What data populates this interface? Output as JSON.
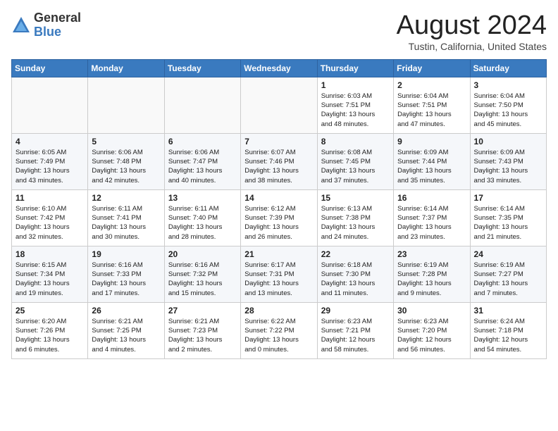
{
  "header": {
    "logo_line1": "General",
    "logo_line2": "Blue",
    "month_title": "August 2024",
    "location": "Tustin, California, United States"
  },
  "weekdays": [
    "Sunday",
    "Monday",
    "Tuesday",
    "Wednesday",
    "Thursday",
    "Friday",
    "Saturday"
  ],
  "weeks": [
    [
      {
        "day": "",
        "info": ""
      },
      {
        "day": "",
        "info": ""
      },
      {
        "day": "",
        "info": ""
      },
      {
        "day": "",
        "info": ""
      },
      {
        "day": "1",
        "info": "Sunrise: 6:03 AM\nSunset: 7:51 PM\nDaylight: 13 hours\nand 48 minutes."
      },
      {
        "day": "2",
        "info": "Sunrise: 6:04 AM\nSunset: 7:51 PM\nDaylight: 13 hours\nand 47 minutes."
      },
      {
        "day": "3",
        "info": "Sunrise: 6:04 AM\nSunset: 7:50 PM\nDaylight: 13 hours\nand 45 minutes."
      }
    ],
    [
      {
        "day": "4",
        "info": "Sunrise: 6:05 AM\nSunset: 7:49 PM\nDaylight: 13 hours\nand 43 minutes."
      },
      {
        "day": "5",
        "info": "Sunrise: 6:06 AM\nSunset: 7:48 PM\nDaylight: 13 hours\nand 42 minutes."
      },
      {
        "day": "6",
        "info": "Sunrise: 6:06 AM\nSunset: 7:47 PM\nDaylight: 13 hours\nand 40 minutes."
      },
      {
        "day": "7",
        "info": "Sunrise: 6:07 AM\nSunset: 7:46 PM\nDaylight: 13 hours\nand 38 minutes."
      },
      {
        "day": "8",
        "info": "Sunrise: 6:08 AM\nSunset: 7:45 PM\nDaylight: 13 hours\nand 37 minutes."
      },
      {
        "day": "9",
        "info": "Sunrise: 6:09 AM\nSunset: 7:44 PM\nDaylight: 13 hours\nand 35 minutes."
      },
      {
        "day": "10",
        "info": "Sunrise: 6:09 AM\nSunset: 7:43 PM\nDaylight: 13 hours\nand 33 minutes."
      }
    ],
    [
      {
        "day": "11",
        "info": "Sunrise: 6:10 AM\nSunset: 7:42 PM\nDaylight: 13 hours\nand 32 minutes."
      },
      {
        "day": "12",
        "info": "Sunrise: 6:11 AM\nSunset: 7:41 PM\nDaylight: 13 hours\nand 30 minutes."
      },
      {
        "day": "13",
        "info": "Sunrise: 6:11 AM\nSunset: 7:40 PM\nDaylight: 13 hours\nand 28 minutes."
      },
      {
        "day": "14",
        "info": "Sunrise: 6:12 AM\nSunset: 7:39 PM\nDaylight: 13 hours\nand 26 minutes."
      },
      {
        "day": "15",
        "info": "Sunrise: 6:13 AM\nSunset: 7:38 PM\nDaylight: 13 hours\nand 24 minutes."
      },
      {
        "day": "16",
        "info": "Sunrise: 6:14 AM\nSunset: 7:37 PM\nDaylight: 13 hours\nand 23 minutes."
      },
      {
        "day": "17",
        "info": "Sunrise: 6:14 AM\nSunset: 7:35 PM\nDaylight: 13 hours\nand 21 minutes."
      }
    ],
    [
      {
        "day": "18",
        "info": "Sunrise: 6:15 AM\nSunset: 7:34 PM\nDaylight: 13 hours\nand 19 minutes."
      },
      {
        "day": "19",
        "info": "Sunrise: 6:16 AM\nSunset: 7:33 PM\nDaylight: 13 hours\nand 17 minutes."
      },
      {
        "day": "20",
        "info": "Sunrise: 6:16 AM\nSunset: 7:32 PM\nDaylight: 13 hours\nand 15 minutes."
      },
      {
        "day": "21",
        "info": "Sunrise: 6:17 AM\nSunset: 7:31 PM\nDaylight: 13 hours\nand 13 minutes."
      },
      {
        "day": "22",
        "info": "Sunrise: 6:18 AM\nSunset: 7:30 PM\nDaylight: 13 hours\nand 11 minutes."
      },
      {
        "day": "23",
        "info": "Sunrise: 6:19 AM\nSunset: 7:28 PM\nDaylight: 13 hours\nand 9 minutes."
      },
      {
        "day": "24",
        "info": "Sunrise: 6:19 AM\nSunset: 7:27 PM\nDaylight: 13 hours\nand 7 minutes."
      }
    ],
    [
      {
        "day": "25",
        "info": "Sunrise: 6:20 AM\nSunset: 7:26 PM\nDaylight: 13 hours\nand 6 minutes."
      },
      {
        "day": "26",
        "info": "Sunrise: 6:21 AM\nSunset: 7:25 PM\nDaylight: 13 hours\nand 4 minutes."
      },
      {
        "day": "27",
        "info": "Sunrise: 6:21 AM\nSunset: 7:23 PM\nDaylight: 13 hours\nand 2 minutes."
      },
      {
        "day": "28",
        "info": "Sunrise: 6:22 AM\nSunset: 7:22 PM\nDaylight: 13 hours\nand 0 minutes."
      },
      {
        "day": "29",
        "info": "Sunrise: 6:23 AM\nSunset: 7:21 PM\nDaylight: 12 hours\nand 58 minutes."
      },
      {
        "day": "30",
        "info": "Sunrise: 6:23 AM\nSunset: 7:20 PM\nDaylight: 12 hours\nand 56 minutes."
      },
      {
        "day": "31",
        "info": "Sunrise: 6:24 AM\nSunset: 7:18 PM\nDaylight: 12 hours\nand 54 minutes."
      }
    ]
  ]
}
